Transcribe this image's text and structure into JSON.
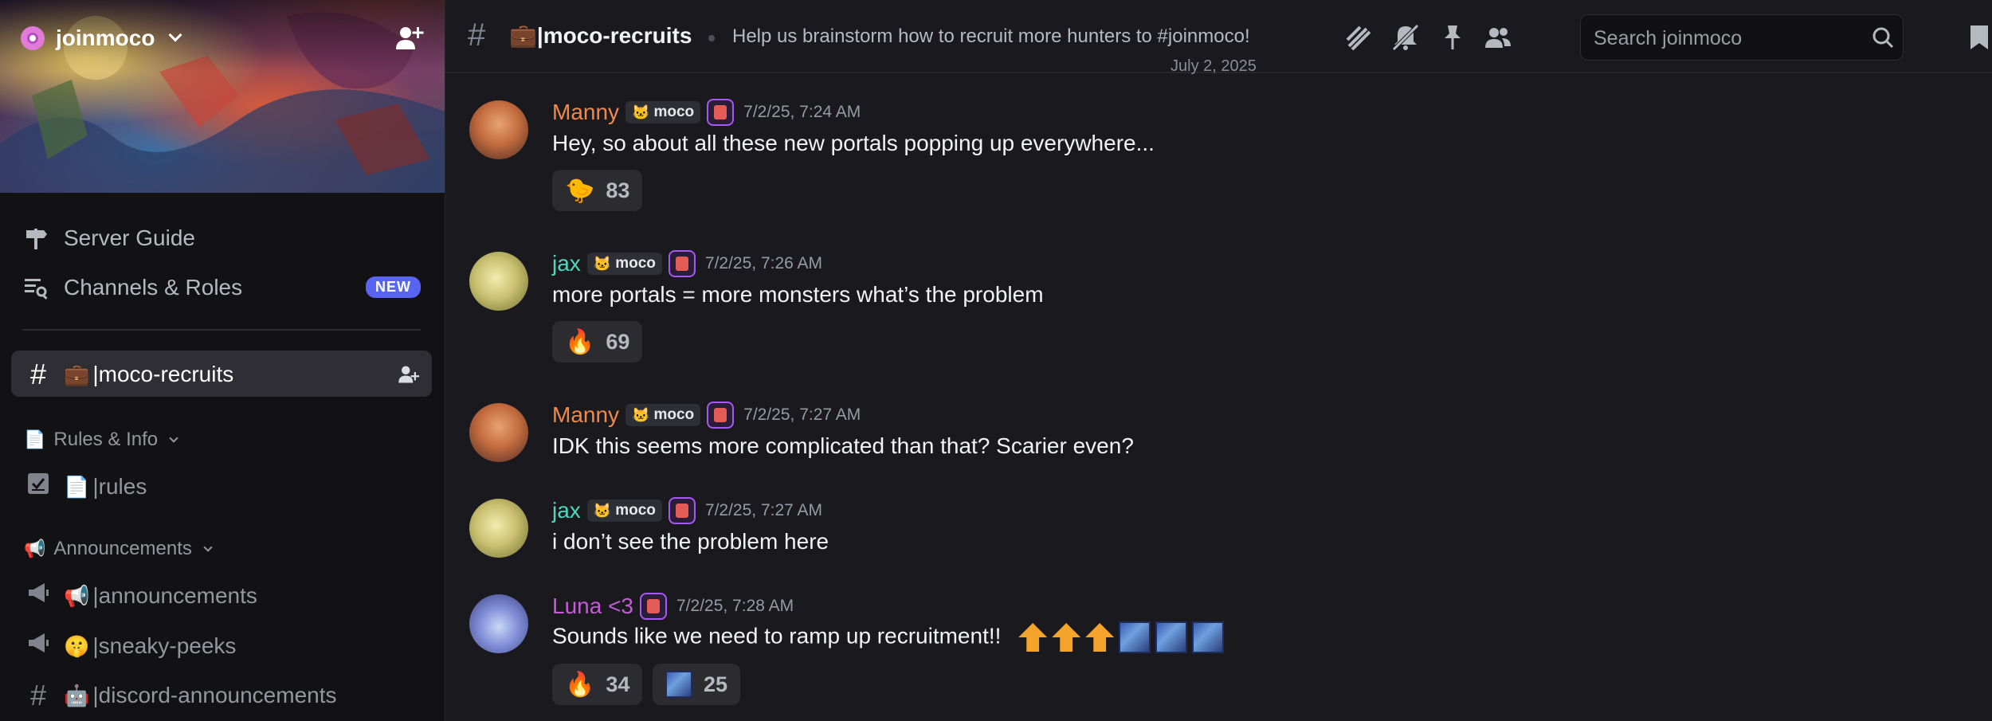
{
  "server": {
    "name": "joinmoco"
  },
  "sidebar": {
    "server_guide": "Server Guide",
    "channels_roles": "Channels & Roles",
    "new_badge": "NEW",
    "active_channel": {
      "emoji": "💼",
      "name": "|moco-recruits"
    },
    "categories": [
      {
        "label": "Rules & Info",
        "emoji": "📄"
      },
      {
        "label": "Announcements",
        "emoji": "📢"
      }
    ],
    "channels": [
      {
        "emoji": "📄",
        "name": "|rules",
        "icon": "rules-checkbox-icon"
      },
      {
        "emoji": "📢",
        "name": "|announcements",
        "icon": "megaphone-icon"
      },
      {
        "emoji": "🤫",
        "name": "|sneaky-peeks",
        "icon": "megaphone-icon"
      },
      {
        "emoji": "🤖",
        "name": "|discord-announcements",
        "icon": "hash-icon"
      }
    ]
  },
  "topbar": {
    "channel_emoji": "💼",
    "channel_name": "|moco-recruits",
    "topic": "Help us brainstorm how to recruit more hunters to #joinmoco!",
    "search_placeholder": "Search joinmoco",
    "icons": [
      "threads-icon",
      "mute-icon",
      "pin-icon",
      "members-icon",
      "inbox-icon"
    ]
  },
  "date_peek": "July 2, 2025",
  "messages": [
    {
      "author": "Manny",
      "color": "#f0894a",
      "tag": "moco",
      "time": "7/2/25, 7:24 AM",
      "text": "Hey, so about all these new portals popping up everywhere...",
      "reactions": [
        {
          "emoji": "🐤",
          "count": "83"
        }
      ]
    },
    {
      "author": "jax",
      "color": "#4fd8c0",
      "tag": "moco",
      "time": "7/2/25, 7:26 AM",
      "text": "more portals =  more monsters what’s the problem",
      "reactions": [
        {
          "emoji": "🔥",
          "count": "69"
        }
      ]
    },
    {
      "author": "Manny",
      "color": "#f0894a",
      "tag": "moco",
      "time": "7/2/25, 7:27 AM",
      "text": "IDK this seems more complicated than that? Scarier even?",
      "reactions": []
    },
    {
      "author": "jax",
      "color": "#4fd8c0",
      "tag": "moco",
      "time": "7/2/25, 7:27 AM",
      "text": "i don’t see the problem here",
      "reactions": []
    },
    {
      "author": "Luna <3",
      "color": "#c65ad9",
      "tag": "",
      "time": "7/2/25, 7:28 AM",
      "text": "Sounds like we need to ramp up recruitment!!",
      "reactions": [
        {
          "emoji": "🔥",
          "count": "34"
        },
        {
          "emoji": "custom-hunter-emoji",
          "count": "25"
        }
      ]
    }
  ]
}
